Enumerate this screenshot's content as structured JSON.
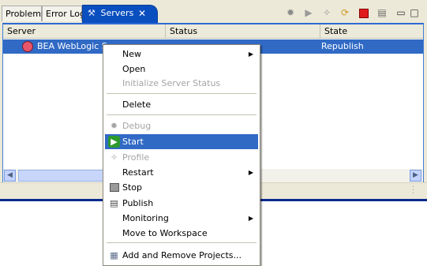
{
  "tabs": {
    "problems": "Problems",
    "error_log": "Error Log",
    "servers": "Servers",
    "servers_close": "✕"
  },
  "toolbar_icons": [
    "debug-icon",
    "start-icon",
    "profile-icon",
    "restart-icon",
    "stop-icon",
    "publish-icon",
    "minimize-icon",
    "maximize-icon"
  ],
  "table": {
    "headers": [
      "Server",
      "Status",
      "State"
    ],
    "rows": [
      {
        "server": "BEA WebLogic Se",
        "status": "",
        "state": "Republish"
      }
    ]
  },
  "context_menu": {
    "new": "New",
    "open": "Open",
    "init_status": "Initialize Server Status",
    "delete": "Delete",
    "debug": "Debug",
    "start": "Start",
    "profile": "Profile",
    "restart": "Restart",
    "stop": "Stop",
    "publish": "Publish",
    "monitoring": "Monitoring",
    "move_to_workspace": "Move to Workspace",
    "add_remove_projects": "Add and Remove Projects..."
  },
  "colors": {
    "selection": "#316ac5",
    "active_tab": "#0a4fbf",
    "chrome": "#ece9d8"
  }
}
